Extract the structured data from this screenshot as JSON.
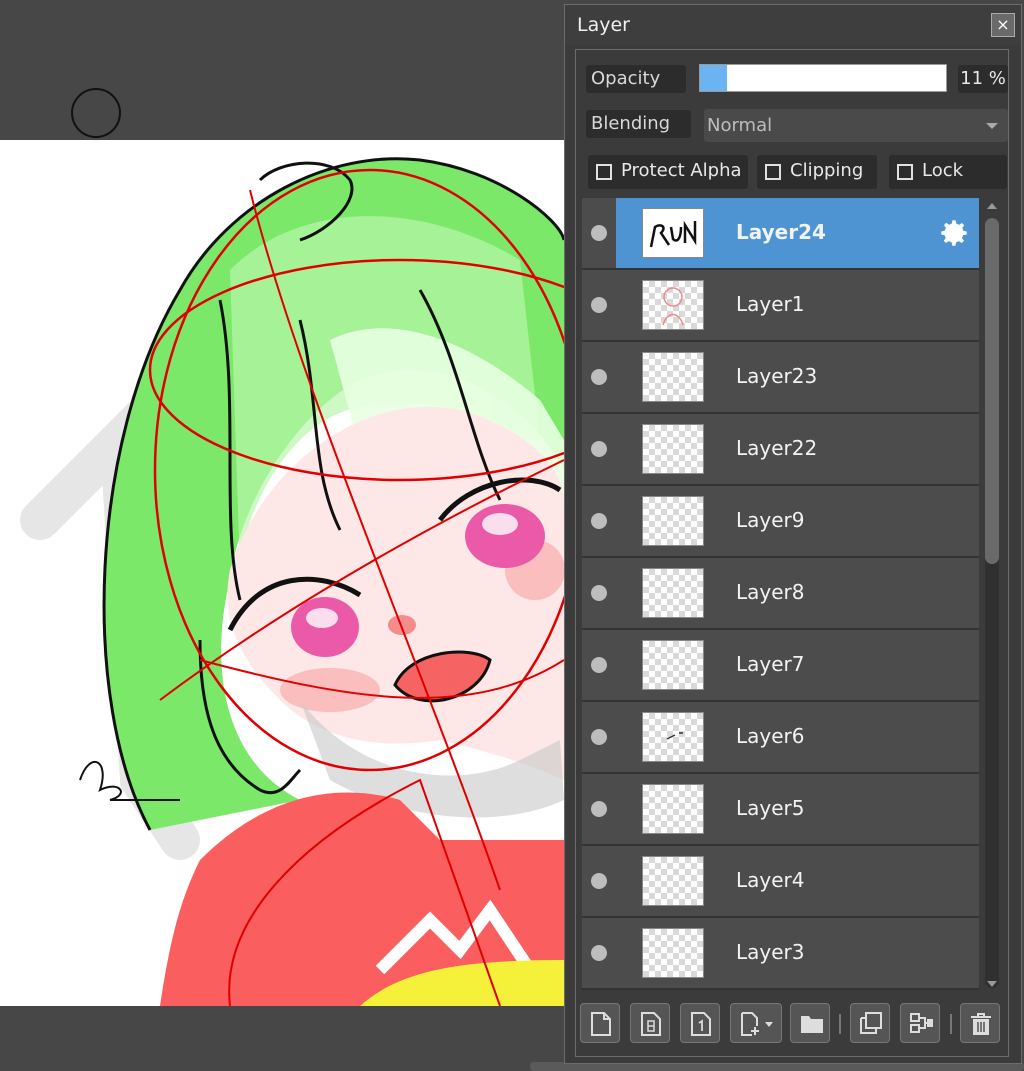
{
  "panel": {
    "title": "Layer",
    "close_glyph": "×",
    "opacity_label": "Opacity",
    "opacity_percent": 11,
    "opacity_value": "11",
    "opacity_unit": "%",
    "blending_label": "Blending",
    "blending_value": "Normal",
    "protect_alpha_label": "Protect Alpha",
    "clipping_label": "Clipping",
    "lock_label": "Lock"
  },
  "layers": [
    {
      "name": "Layer24",
      "selected": true,
      "thumb_text": "RUN"
    },
    {
      "name": "Layer1"
    },
    {
      "name": "Layer23"
    },
    {
      "name": "Layer22"
    },
    {
      "name": "Layer9"
    },
    {
      "name": "Layer8"
    },
    {
      "name": "Layer7"
    },
    {
      "name": "Layer6"
    },
    {
      "name": "Layer5"
    },
    {
      "name": "Layer4"
    },
    {
      "name": "Layer3"
    }
  ],
  "toolbar_icons": [
    "new-layer-icon",
    "new-8bit-layer-icon",
    "new-1bit-layer-icon",
    "add-layer-dropdown-icon",
    "new-folder-icon",
    "duplicate-layer-icon",
    "merge-down-icon",
    "delete-layer-icon"
  ],
  "colors": {
    "selected": "#4e93d2",
    "panel": "#3b3b3b",
    "opacity_fill": "#6ab4f2"
  }
}
